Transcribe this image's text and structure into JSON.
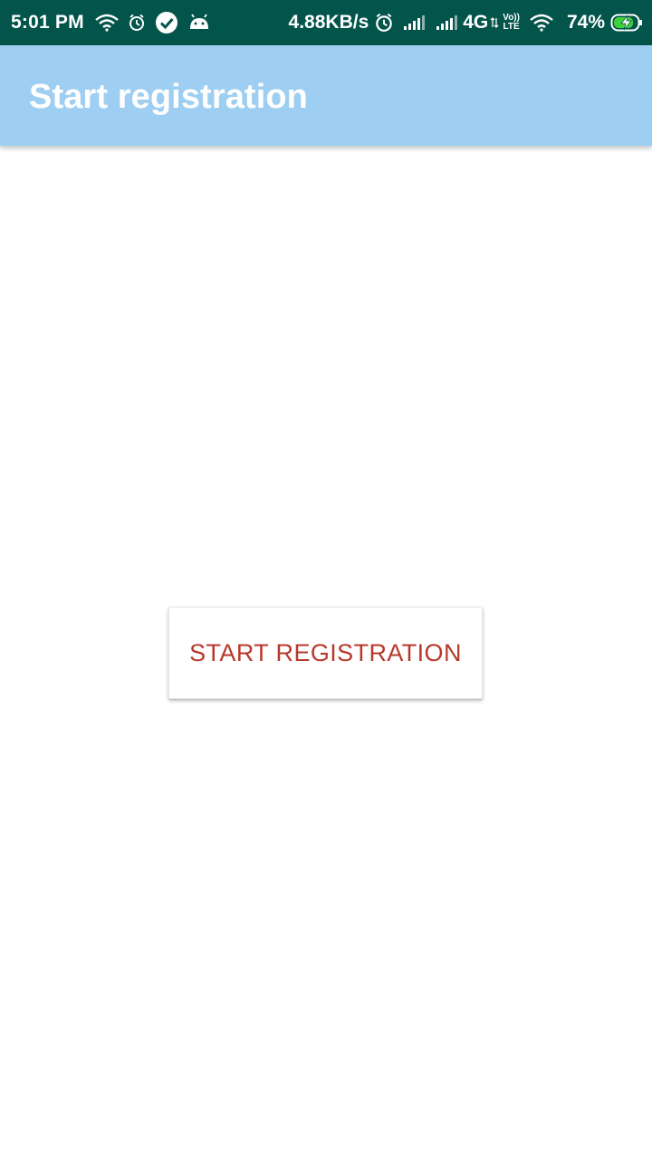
{
  "status_bar": {
    "time": "5:01 PM",
    "net_speed": "4.88KB/s",
    "network_type": "4G",
    "volte_top": "Vo))",
    "volte_bottom": "LTE",
    "battery_percent": "74%",
    "icons": [
      "wifi-icon",
      "alarm-icon",
      "check-circle-icon",
      "android-icon",
      "alarm-icon",
      "signal-icon",
      "signal-icon",
      "wifi-icon",
      "battery-charging-icon"
    ],
    "background_color": "#03544a"
  },
  "app_bar": {
    "title": "Start registration",
    "background_color": "#9ecff2"
  },
  "main": {
    "start_button_label": "START REGISTRATION",
    "button_text_color": "#b8392c"
  }
}
